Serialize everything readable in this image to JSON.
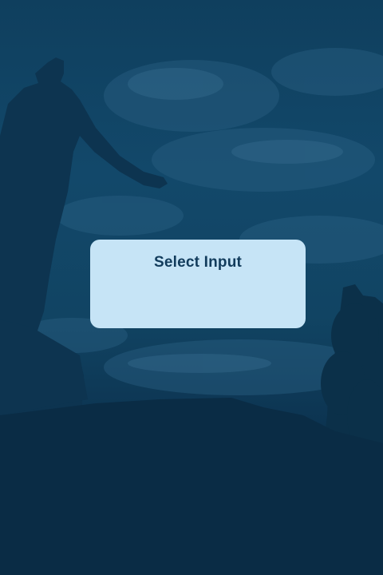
{
  "background": {
    "scene": "statue-silhouette-dusk-photo",
    "overlay_color": "#0f3f5e"
  },
  "dialog": {
    "title": "Select Input",
    "background_color": "#c6e4f6",
    "title_color": "#123c5c",
    "options": []
  }
}
